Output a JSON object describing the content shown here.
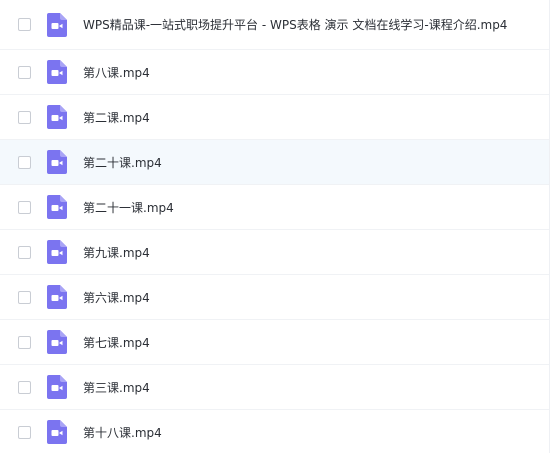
{
  "colors": {
    "video_icon": "#7b74f0",
    "video_icon_fold": "#a9a4f6",
    "hover_row": "#f4f9fd",
    "text": "#2b2f36"
  },
  "icon_name": "video-file-icon",
  "files": [
    {
      "name": "WPS精品课-一站式职场提升平台 - WPS表格 演示 文档在线学习-课程介绍.mp4"
    },
    {
      "name": "第八课.mp4"
    },
    {
      "name": "第二课.mp4"
    },
    {
      "name": "第二十课.mp4"
    },
    {
      "name": "第二十一课.mp4"
    },
    {
      "name": "第九课.mp4"
    },
    {
      "name": "第六课.mp4"
    },
    {
      "name": "第七课.mp4"
    },
    {
      "name": "第三课.mp4"
    },
    {
      "name": "第十八课.mp4"
    }
  ]
}
